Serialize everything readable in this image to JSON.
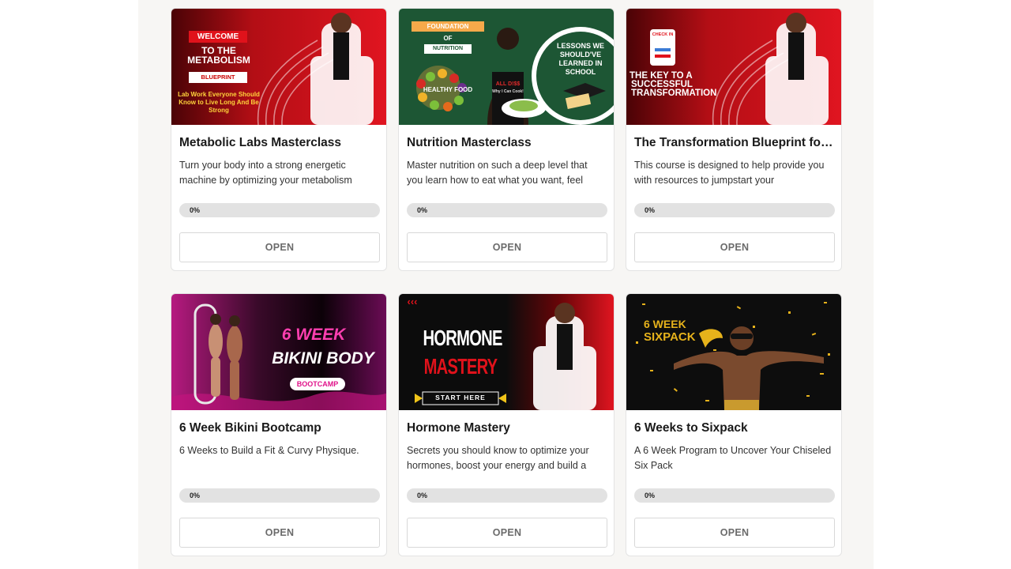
{
  "courses": [
    {
      "title": "Metabolic Labs Masterclass",
      "description": "Turn your body into a strong energetic machine by optimizing your metabolism",
      "progress_label": "0%",
      "progress": 0,
      "button_label": "OPEN",
      "banner": {
        "welcome": "WELCOME",
        "line1": "TO THE",
        "line2": "METABOLISM",
        "tag": "BLUEPRINT",
        "subtitle": "Lab Work Everyone Should Know to Live Long And Be Strong"
      }
    },
    {
      "title": "Nutrition Masterclass",
      "description": "Master nutrition on such a deep level that you learn how to eat what you want, feel",
      "progress_label": "0%",
      "progress": 0,
      "button_label": "OPEN",
      "banner": {
        "foundation": "FOUNDATION",
        "of": "OF",
        "nutrition": "NUTRITION",
        "healthy_food": "HEALTHY FOOD",
        "apron_line1": "ALL D!$$",
        "apron_line2": "Why I Can Cook!",
        "lessons": "LESSONS WE SHOULD'VE LEARNED IN SCHOOL"
      }
    },
    {
      "title": "The Transformation Blueprint for ...",
      "description": "This course is designed to help provide you with resources to jumpstart your",
      "progress_label": "0%",
      "progress": 0,
      "button_label": "OPEN",
      "banner": {
        "checkin": "CHECK IN",
        "line1": "THE KEY TO A",
        "line2": "SUCCESSFUL",
        "line3": "TRANSFORMATION"
      }
    },
    {
      "title": "6 Week Bikini Bootcamp",
      "description": "6 Weeks to Build a Fit & Curvy Physique.",
      "progress_label": "0%",
      "progress": 0,
      "button_label": "OPEN",
      "banner": {
        "line1": "6 WEEK",
        "line2": "BIKINI BODY",
        "tag": "BOOTCAMP"
      }
    },
    {
      "title": "Hormone Mastery",
      "description": "Secrets you should know to optimize your hormones, boost your energy and build a",
      "progress_label": "0%",
      "progress": 0,
      "button_label": "OPEN",
      "banner": {
        "arrows": "‹‹‹",
        "line1": "HORMONE",
        "line2": "MASTERY",
        "tag": "START HERE"
      }
    },
    {
      "title": "6 Weeks to Sixpack",
      "description": "A 6 Week Program to Uncover Your Chiseled Six Pack",
      "progress_label": "0%",
      "progress": 0,
      "button_label": "OPEN",
      "banner": {
        "line1": "6 WEEK",
        "line2": "SIXPACK"
      }
    }
  ],
  "colors": {
    "brand_red": "#d7141c",
    "dark_red": "#4a0306",
    "nutrition_green": "#1d5634",
    "bikini_magenta": "#d4148a",
    "sixpack_gold": "#e6b21b"
  }
}
